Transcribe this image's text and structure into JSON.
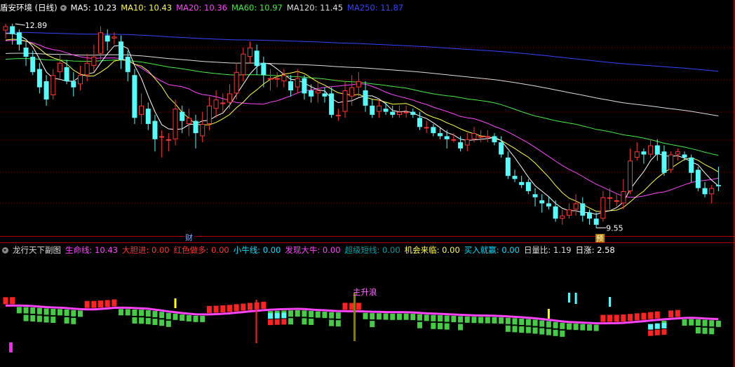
{
  "main_header": {
    "title": "盾安环境 (日线)",
    "ma": [
      {
        "label": "MA5: 10.23",
        "color": "#ffffff"
      },
      {
        "label": "MA10: 10.43",
        "color": "#ffff44"
      },
      {
        "label": "MA20: 10.36",
        "color": "#ff44ff"
      },
      {
        "label": "MA60: 10.97",
        "color": "#44ee44"
      },
      {
        "label": "MA120: 11.45",
        "color": "#dddddd"
      },
      {
        "label": "MA250: 11.87",
        "color": "#3344ff"
      }
    ]
  },
  "sub_header": {
    "title": "龙行天下副图",
    "items": [
      {
        "label": "生命线: 10.43",
        "color": "#ff44ff"
      },
      {
        "label": "大胆进: 0.00",
        "color": "#ff3333"
      },
      {
        "label": "红色做多: 0.00",
        "color": "#ff3333"
      },
      {
        "label": "小牛线: 0.00",
        "color": "#00e0ff"
      },
      {
        "label": "发现大牛: 0.00",
        "color": "#ff44ff"
      },
      {
        "label": "超级短线: 0.00",
        "color": "#00a0a0"
      },
      {
        "label": "机会来临: 0.00",
        "color": "#ffff44"
      },
      {
        "label": "买入就赢: 0.00",
        "color": "#00e0ff"
      },
      {
        "label": "日量比: 1.19",
        "color": "#dddddd"
      },
      {
        "label": "日涨: 2.58",
        "color": "#ffffff"
      }
    ]
  },
  "annotations": {
    "high_label": "12.89",
    "low_label": "9.55",
    "cai_marker": "财",
    "yu_marker": "预",
    "zhushenglang": "主升浪"
  },
  "colors": {
    "up": "#ff3333",
    "down": "#54fcfc",
    "grid": "#7a0000",
    "axis": "#b00000",
    "ma5": "#ffffff",
    "ma10": "#ffff44",
    "ma20": "#ff44ff",
    "ma60": "#44ee44",
    "ma120": "#dddddd",
    "ma250": "#3344ff",
    "life_line": "#ff44ff",
    "bar_green": "#44cc44",
    "bar_red": "#ff2222",
    "cyan": "#54fcfc",
    "yellow": "#ffff00",
    "magenta": "#ff22ff",
    "olive": "#808000"
  },
  "chart_data": {
    "type": "candlestick",
    "price_range": [
      9.45,
      13.05
    ],
    "candles": [
      [
        12.78,
        12.85,
        12.65,
        12.89
      ],
      [
        12.85,
        12.72,
        12.55,
        12.89
      ],
      [
        12.75,
        12.55,
        12.45,
        12.8
      ],
      [
        12.5,
        12.35,
        12.2,
        12.6
      ],
      [
        12.35,
        12.1,
        12.05,
        12.45
      ],
      [
        12.15,
        11.85,
        11.75,
        12.25
      ],
      [
        11.95,
        11.65,
        11.55,
        12.05
      ],
      [
        11.72,
        12.05,
        11.65,
        12.15
      ],
      [
        12.1,
        12.25,
        12.0,
        12.4
      ],
      [
        12.18,
        11.95,
        11.9,
        12.3
      ],
      [
        11.95,
        11.85,
        11.7,
        12.1
      ],
      [
        11.9,
        12.05,
        11.8,
        12.2
      ],
      [
        12.05,
        12.25,
        11.95,
        12.4
      ],
      [
        12.2,
        12.35,
        12.1,
        12.55
      ],
      [
        12.4,
        12.75,
        12.3,
        12.85
      ],
      [
        12.7,
        12.6,
        12.45,
        12.8
      ],
      [
        12.65,
        12.68,
        12.55,
        12.75
      ],
      [
        12.6,
        12.3,
        12.15,
        12.7
      ],
      [
        12.35,
        12.1,
        11.95,
        12.45
      ],
      [
        12.05,
        11.35,
        11.25,
        12.15
      ],
      [
        11.4,
        11.55,
        11.25,
        11.75
      ],
      [
        11.5,
        11.25,
        11.15,
        11.6
      ],
      [
        11.3,
        11.0,
        10.8,
        11.4
      ],
      [
        11.05,
        11.05,
        10.7,
        11.15
      ],
      [
        11.0,
        11.0,
        10.8,
        11.1
      ],
      [
        11.0,
        11.5,
        10.9,
        11.65
      ],
      [
        11.45,
        11.3,
        11.1,
        11.55
      ],
      [
        11.25,
        11.35,
        11.05,
        11.5
      ],
      [
        11.3,
        11.1,
        10.85,
        11.4
      ],
      [
        11.05,
        11.25,
        10.95,
        11.45
      ],
      [
        11.25,
        11.55,
        11.15,
        11.7
      ],
      [
        11.5,
        11.65,
        11.35,
        11.8
      ],
      [
        11.6,
        11.6,
        11.45,
        11.75
      ],
      [
        11.6,
        11.75,
        11.5,
        11.9
      ],
      [
        11.75,
        12.1,
        11.65,
        12.25
      ],
      [
        12.05,
        12.4,
        11.95,
        12.5
      ],
      [
        12.35,
        12.5,
        12.25,
        12.6
      ],
      [
        12.45,
        12.2,
        12.05,
        12.55
      ],
      [
        12.25,
        12.05,
        11.85,
        12.35
      ],
      [
        12.0,
        12.0,
        11.8,
        12.15
      ],
      [
        12.0,
        12.0,
        11.85,
        12.1
      ],
      [
        11.95,
        12.05,
        11.85,
        12.15
      ],
      [
        11.95,
        11.8,
        11.7,
        12.05
      ],
      [
        11.85,
        12.0,
        11.75,
        12.15
      ],
      [
        12.0,
        11.75,
        11.65,
        12.05
      ],
      [
        11.8,
        11.7,
        11.6,
        11.9
      ],
      [
        11.75,
        11.8,
        11.6,
        11.95
      ],
      [
        11.75,
        11.7,
        11.6,
        11.85
      ],
      [
        11.75,
        11.4,
        11.35,
        11.85
      ],
      [
        11.4,
        11.4,
        11.3,
        11.5
      ],
      [
        11.45,
        11.8,
        11.35,
        11.95
      ],
      [
        11.7,
        11.85,
        11.55,
        12.05
      ],
      [
        11.85,
        11.95,
        11.7,
        12.1
      ],
      [
        11.8,
        11.55,
        11.45,
        11.95
      ],
      [
        11.55,
        11.4,
        11.35,
        11.65
      ],
      [
        11.45,
        11.55,
        11.35,
        11.65
      ],
      [
        11.5,
        11.45,
        11.4,
        11.6
      ],
      [
        11.45,
        11.4,
        11.35,
        11.55
      ],
      [
        11.4,
        11.45,
        11.35,
        11.55
      ],
      [
        11.45,
        11.45,
        11.35,
        11.55
      ],
      [
        11.45,
        11.4,
        11.35,
        11.5
      ],
      [
        11.35,
        11.2,
        11.15,
        11.45
      ],
      [
        11.2,
        11.2,
        11.1,
        11.3
      ],
      [
        11.2,
        11.1,
        11.05,
        11.25
      ],
      [
        11.1,
        11.05,
        11.0,
        11.2
      ],
      [
        11.05,
        11.0,
        10.85,
        11.15
      ],
      [
        11.0,
        11.0,
        10.95,
        11.1
      ],
      [
        10.95,
        10.85,
        10.8,
        11.05
      ],
      [
        10.9,
        11.0,
        10.8,
        11.1
      ],
      [
        11.0,
        11.1,
        10.95,
        11.2
      ],
      [
        11.05,
        11.05,
        10.95,
        11.15
      ],
      [
        11.05,
        11.05,
        10.95,
        11.15
      ],
      [
        11.05,
        10.95,
        10.9,
        11.1
      ],
      [
        10.95,
        10.75,
        10.7,
        11.05
      ],
      [
        10.7,
        10.4,
        10.35,
        10.8
      ],
      [
        10.4,
        10.35,
        10.3,
        10.5
      ],
      [
        10.3,
        10.25,
        10.2,
        10.4
      ],
      [
        10.3,
        10.15,
        10.1,
        10.35
      ],
      [
        10.1,
        10.05,
        9.9,
        10.2
      ],
      [
        10.0,
        9.95,
        9.8,
        10.1
      ],
      [
        9.95,
        9.9,
        9.85,
        10.05
      ],
      [
        9.9,
        9.7,
        9.65,
        10.0
      ],
      [
        9.7,
        9.75,
        9.6,
        9.85
      ],
      [
        9.75,
        9.85,
        9.7,
        9.95
      ],
      [
        9.85,
        9.95,
        9.75,
        10.1
      ],
      [
        9.95,
        9.75,
        9.65,
        10.05
      ],
      [
        9.8,
        9.7,
        9.6,
        9.85
      ],
      [
        9.7,
        9.6,
        9.55,
        9.8
      ],
      [
        9.7,
        10.05,
        9.65,
        10.15
      ],
      [
        10.05,
        10.05,
        9.85,
        10.2
      ],
      [
        10.0,
        10.0,
        9.9,
        10.1
      ],
      [
        9.95,
        10.15,
        9.85,
        10.35
      ],
      [
        10.15,
        10.65,
        10.1,
        10.85
      ],
      [
        10.7,
        10.8,
        10.65,
        10.95
      ],
      [
        10.8,
        10.75,
        10.6,
        10.85
      ],
      [
        10.75,
        10.9,
        10.7,
        11.0
      ],
      [
        10.9,
        10.75,
        10.65,
        11.0
      ],
      [
        10.8,
        10.45,
        10.4,
        10.9
      ],
      [
        10.5,
        10.75,
        10.45,
        10.8
      ],
      [
        10.75,
        10.8,
        10.65,
        10.85
      ],
      [
        10.75,
        10.7,
        10.65,
        10.8
      ],
      [
        10.7,
        10.45,
        10.3,
        10.75
      ],
      [
        10.5,
        10.2,
        10.15,
        10.55
      ],
      [
        10.2,
        10.1,
        10.05,
        10.3
      ],
      [
        10.1,
        10.2,
        9.95,
        10.25
      ],
      [
        10.25,
        10.23,
        10.15,
        10.55
      ]
    ]
  }
}
